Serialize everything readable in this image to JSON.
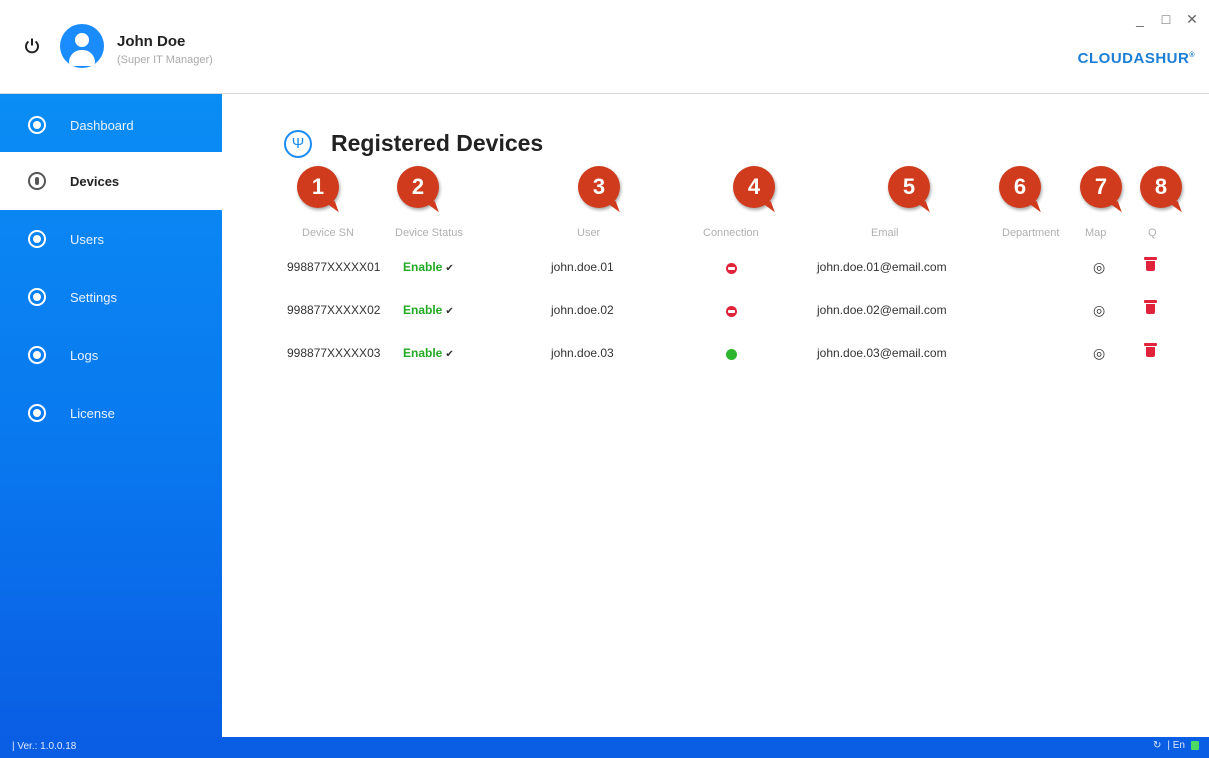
{
  "header": {
    "user_name": "John Doe",
    "user_role": "(Super IT Manager)",
    "brand": "CLOUDASHUR",
    "brand_mark": "®",
    "window_controls": [
      "_",
      "□",
      "✕"
    ]
  },
  "sidebar": {
    "items": [
      {
        "label": "Dashboard",
        "icon": "dashboard-icon"
      },
      {
        "label": "Devices",
        "icon": "usb-icon",
        "active": true
      },
      {
        "label": "Users",
        "icon": "user-icon"
      },
      {
        "label": "Settings",
        "icon": "settings-icon"
      },
      {
        "label": "Logs",
        "icon": "logs-icon"
      },
      {
        "label": "License",
        "icon": "license-icon"
      }
    ]
  },
  "footer": {
    "version": "| Ver.: 1.0.0.18",
    "language": "| En"
  },
  "main": {
    "title": "Registered Devices",
    "title_icon": "usb-icon",
    "badges": [
      "1",
      "2",
      "3",
      "4",
      "5",
      "6",
      "7",
      "8"
    ],
    "columns": [
      "Device SN",
      "Device Status",
      "User",
      "Connection",
      "Email",
      "Department",
      "Map",
      "Q"
    ],
    "rows": [
      {
        "sn": "998877XXXXX01",
        "status": "Enable",
        "user": "john.doe.01",
        "connection": "disconnected",
        "email": "john.doe.01@email.com"
      },
      {
        "sn": "998877XXXXX02",
        "status": "Enable",
        "user": "john.doe.02",
        "connection": "disconnected",
        "email": "john.doe.02@email.com"
      },
      {
        "sn": "998877XXXXX03",
        "status": "Enable",
        "user": "john.doe.03",
        "connection": "connected",
        "email": "john.doe.03@email.com"
      }
    ]
  },
  "colors": {
    "sidebar_blue": "#0a8df5",
    "status_enable": "#22aa22",
    "connected": "#2db52d",
    "disconnected": "#e0233a",
    "badge": "#cf3b1c",
    "trash": "#e0233a"
  }
}
